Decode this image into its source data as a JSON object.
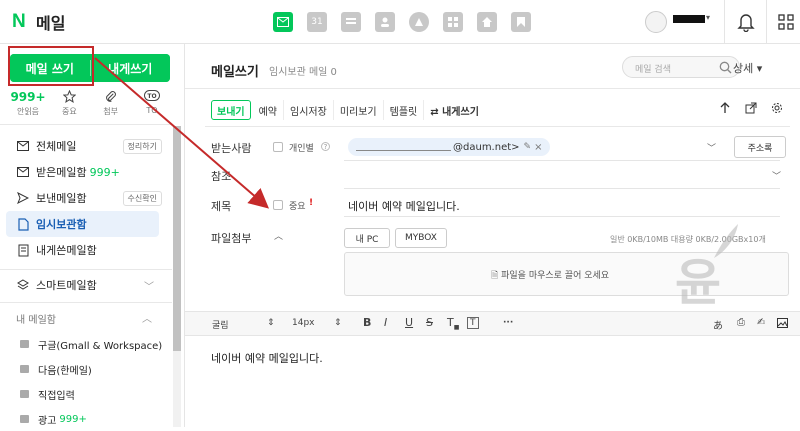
{
  "header": {
    "logo_letter": "N",
    "app_name": "메일",
    "app_icons": [
      "mail-icon",
      "calendar-icon",
      "contacts-icon",
      "address-book-icon",
      "drive-icon",
      "memo-icon",
      "home-icon",
      "bookmark-icon"
    ],
    "calendar_num": "31"
  },
  "sidebar": {
    "write_label": "메일 쓰기",
    "self_write_label": "내게쓰기",
    "quick": [
      {
        "num": "999+",
        "label": "안읽음"
      },
      {
        "num": "",
        "label": "중요"
      },
      {
        "num": "",
        "label": "첨부"
      },
      {
        "num": "",
        "label": "TO"
      }
    ],
    "mailboxes": [
      {
        "label": "전체메일",
        "tag": "정리하기"
      },
      {
        "label": "받은메일함",
        "count": "999+"
      },
      {
        "label": "보낸메일함",
        "tag": "수신확인"
      },
      {
        "label": "임시보관함"
      },
      {
        "label": "내게쓴메일함"
      },
      {
        "label": "스마트메일함"
      }
    ],
    "my_section": "내 메일함",
    "folders": [
      {
        "label": "구글(Gmall & Workspace)"
      },
      {
        "label": "다음(한메일)"
      },
      {
        "label": "직접입력"
      },
      {
        "label": "광고",
        "count": "999+"
      }
    ]
  },
  "main": {
    "title": "메일쓰기",
    "subtitle": "임시보관 메일 0",
    "search_placeholder": "메일 검색",
    "detail": "상세",
    "toolbar": {
      "send": "보내기",
      "schedule": "예약",
      "draft": "임시저장",
      "preview": "미리보기",
      "template": "템플릿",
      "self": "⇄ 내게쓰기"
    },
    "recipient_label": "받는사람",
    "private_label": "개인별",
    "recipient_domain": "@daum.net>",
    "recipient_prefix": "",
    "address_book": "주소록",
    "cc_label": "참조",
    "subject_label": "제목",
    "important_label": "중요",
    "important_mark": "!",
    "subject_value": "네이버 예약 메일입니다.",
    "attach_label": "파일첨부",
    "my_pc": "내 PC",
    "mybox": "MYBOX",
    "quota": "일반 0KB/10MB  대용량 0KB/2.00GBx10개",
    "dropzone": "파일을 마우스로 끌어 오세요",
    "editor": {
      "font": "굴림",
      "size": "14px",
      "bold": "B",
      "italic": "I",
      "underline": "U",
      "strike": "S",
      "more": "···"
    },
    "body": "네이버 예약 메일입니다."
  },
  "watermark": "윤",
  "colors": {
    "brand": "#03c75a",
    "annotation": "#c52a2a",
    "active_bg": "#e9f1fb"
  }
}
